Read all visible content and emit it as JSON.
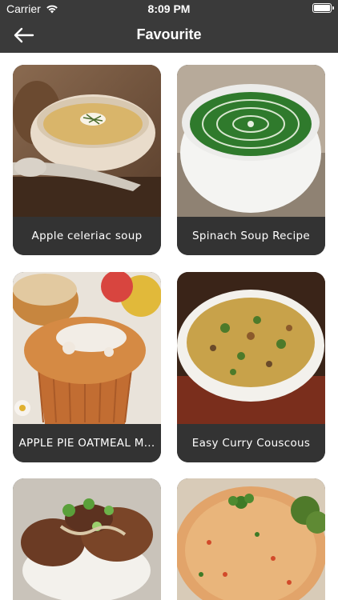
{
  "status": {
    "carrier": "Carrier",
    "time": "8:09 PM"
  },
  "nav": {
    "title": "Favourite",
    "back_icon": "arrow-left-icon"
  },
  "recipes": [
    {
      "title": "Apple  celeriac soup"
    },
    {
      "title": "Spinach Soup Recipe"
    },
    {
      "title": "APPLE PIE OATMEAL M..."
    },
    {
      "title": "Easy Curry Couscous"
    }
  ],
  "colors": {
    "bar": "#3a3a3a",
    "card_label_bg": "#333333",
    "text": "#ffffff"
  }
}
